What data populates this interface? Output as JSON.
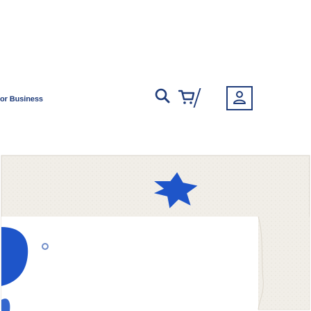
{
  "header": {
    "brand_text": "or Business",
    "search_icon": "search-icon",
    "cart_icon": "cart-icon",
    "account_icon": "account-icon"
  },
  "colors": {
    "brand": "#1f3c7a",
    "hero_blue": "#1e55c9",
    "hero_paper": "#f1eee8"
  },
  "hero": {
    "image": "hero-illustration"
  }
}
